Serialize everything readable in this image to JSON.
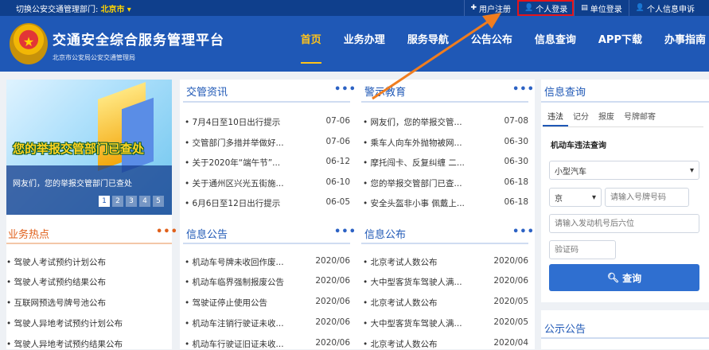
{
  "topbar": {
    "switch_label": "切换公安交通管理部门:",
    "city": "北京市",
    "links": [
      {
        "icon": "plus-icon",
        "label": "用户注册"
      },
      {
        "icon": "user-icon",
        "label": "个人登录"
      },
      {
        "icon": "doc-icon",
        "label": "单位登录"
      },
      {
        "icon": "user-icon",
        "label": "个人信息申诉"
      }
    ]
  },
  "header": {
    "title": "交通安全综合服务管理平台",
    "subtitle": "北京市公安局公安交通管理局",
    "nav": [
      "首页",
      "业务办理",
      "服务导航",
      "公告公布",
      "信息查询",
      "APP下载",
      "办事指南"
    ]
  },
  "banner": {
    "headline": "您的举报交管部门已查处",
    "caption": "网友们，您的举报交管部门已查处",
    "pages": [
      "1",
      "2",
      "3",
      "4",
      "5"
    ]
  },
  "jgzx": {
    "title": "交管资讯",
    "rows": [
      {
        "text": "• 7月4日至10日出行提示",
        "date": "07-06"
      },
      {
        "text": "• 交管部门多措并举做好...",
        "date": "07-06"
      },
      {
        "text": "• 关于2020年“端午节”...",
        "date": "06-12"
      },
      {
        "text": "• 关于通州区兴光五街施...",
        "date": "06-10"
      },
      {
        "text": "• 6月6日至12日出行提示",
        "date": "06-05"
      }
    ]
  },
  "jsjy": {
    "title": "警示教育",
    "rows": [
      {
        "text": "• 网友们，您的举报交管...",
        "date": "07-08"
      },
      {
        "text": "• 乘车人向车外抛物被网...",
        "date": "06-30"
      },
      {
        "text": "• 摩托闯卡、反复纠缠 二...",
        "date": "06-30"
      },
      {
        "text": "• 您的举报交管部门已查...",
        "date": "06-18"
      },
      {
        "text": "• 安全头盔非小事 佩戴上...",
        "date": "06-18"
      }
    ]
  },
  "ywrd": {
    "title": "业务热点",
    "rows": [
      "• 驾驶人考试预约计划公布",
      "• 驾驶人考试预约结果公布",
      "• 互联网预选号牌号池公布",
      "• 驾驶人异地考试预约计划公布",
      "• 驾驶人异地考试预约结果公布"
    ]
  },
  "xxgg": {
    "title": "信息公告",
    "rows": [
      {
        "text": "• 机动车号牌未收回作废...",
        "date": "2020/06"
      },
      {
        "text": "• 机动车临界强制报废公告",
        "date": "2020/06"
      },
      {
        "text": "• 驾驶证停止使用公告",
        "date": "2020/06"
      },
      {
        "text": "• 机动车注销行驶证未收...",
        "date": "2020/06"
      },
      {
        "text": "• 机动车行驶证旧证未收...",
        "date": "2020/06"
      }
    ]
  },
  "xxgb": {
    "title": "信息公布",
    "rows": [
      {
        "text": "• 北京考试人数公布",
        "date": "2020/06"
      },
      {
        "text": "• 大中型客货车驾驶人满...",
        "date": "2020/06"
      },
      {
        "text": "• 北京考试人数公布",
        "date": "2020/05"
      },
      {
        "text": "• 大中型客货车驾驶人满...",
        "date": "2020/05"
      },
      {
        "text": "• 北京考试人数公布",
        "date": "2020/04"
      }
    ]
  },
  "query": {
    "title": "信息查询",
    "tabs": [
      "违法",
      "记分",
      "报废",
      "号牌邮寄"
    ],
    "section": "机动车违法查询",
    "vehicle_type": "小型汽车",
    "province": "京",
    "plate_placeholder": "请输入号牌号码",
    "engine_placeholder": "请输入发动机号后六位",
    "captcha_placeholder": "验证码",
    "button": "查询"
  },
  "gsgg": {
    "title": "公示公告"
  },
  "more_label": "•••",
  "colors": {
    "header": "#1f58b6",
    "topbar": "#0f3f8c",
    "accent": "#ffc31a",
    "highlight": "#e5141a",
    "arrow": "#f07d1f"
  }
}
